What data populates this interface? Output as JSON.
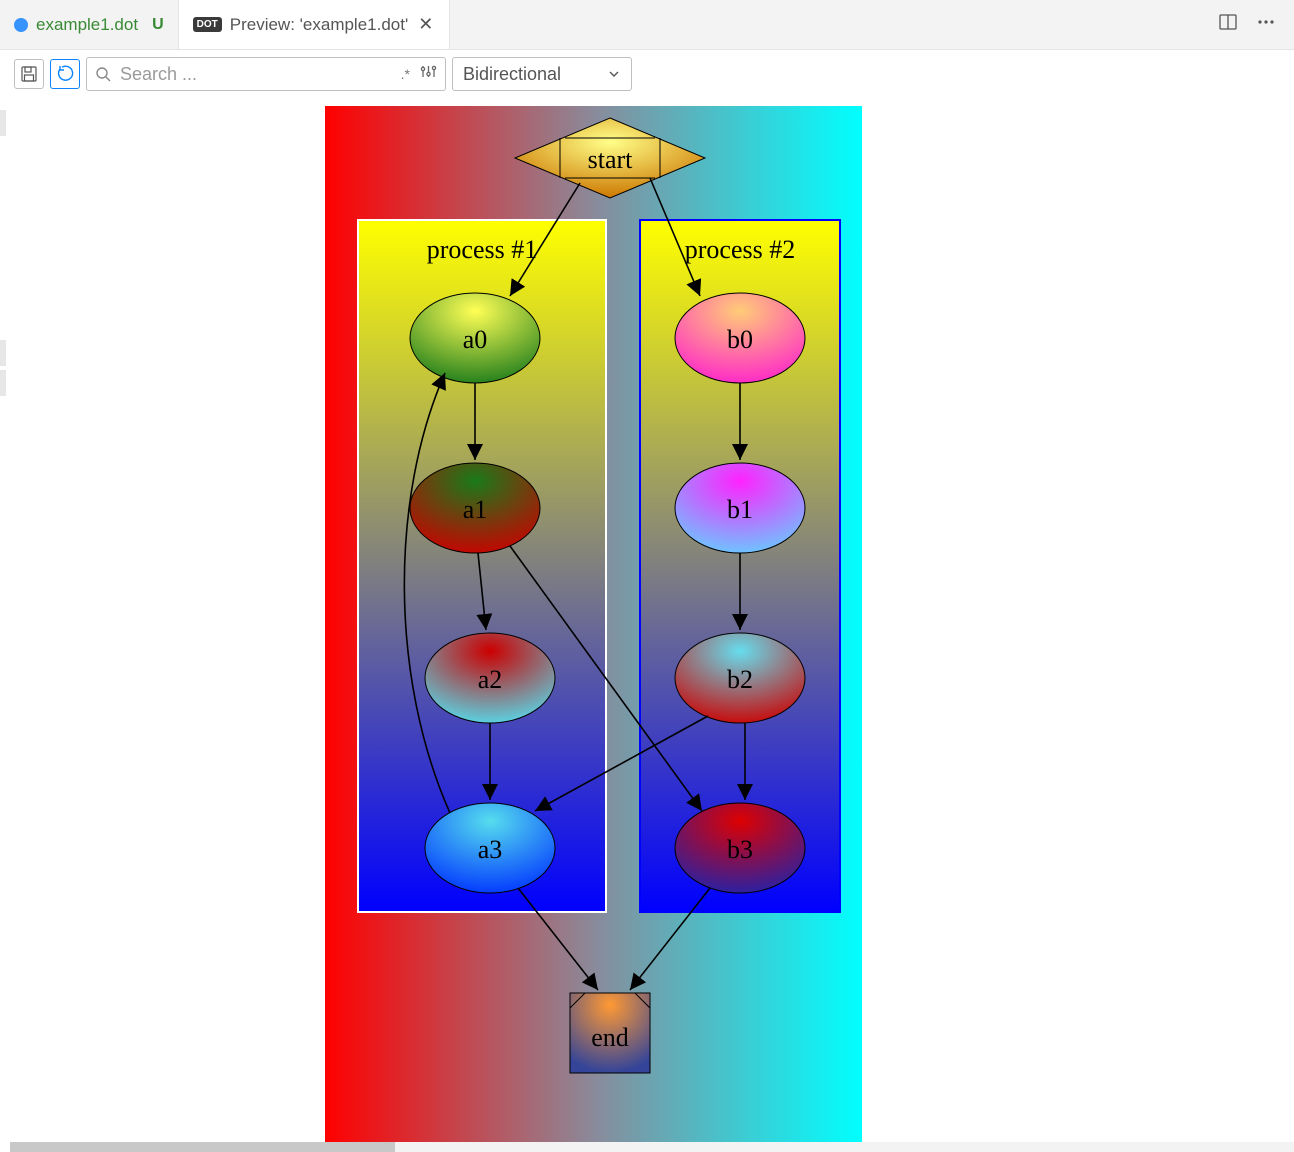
{
  "tabs": [
    {
      "label": "example1.dot",
      "status": "U",
      "icon": "dot-file"
    },
    {
      "label": "Preview: 'example1.dot'",
      "icon": "dot-preview"
    }
  ],
  "toolbar": {
    "search_placeholder": "Search ...",
    "direction_selected": "Bidirectional"
  },
  "graph": {
    "start_label": "start",
    "end_label": "end",
    "cluster1": {
      "title": "process #1",
      "nodes": [
        "a0",
        "a1",
        "a2",
        "a3"
      ]
    },
    "cluster2": {
      "title": "process #2",
      "nodes": [
        "b0",
        "b1",
        "b2",
        "b3"
      ]
    },
    "edges": [
      [
        "start",
        "a0"
      ],
      [
        "start",
        "b0"
      ],
      [
        "a0",
        "a1"
      ],
      [
        "a1",
        "a2"
      ],
      [
        "a2",
        "a3"
      ],
      [
        "b0",
        "b1"
      ],
      [
        "b1",
        "b2"
      ],
      [
        "b2",
        "b3"
      ],
      [
        "a1",
        "b3"
      ],
      [
        "b2",
        "a3"
      ],
      [
        "a3",
        "end"
      ],
      [
        "b3",
        "end"
      ],
      [
        "a3",
        "a0"
      ]
    ],
    "background": {
      "left_color": "#ff0000",
      "right_color": "#00ffff"
    },
    "cluster1_bg": {
      "top": "#ffff00",
      "bottom": "#0000ff",
      "stroke": "#ffffff"
    },
    "cluster2_bg": {
      "top": "#ffff00",
      "bottom": "#0000ff",
      "stroke": "#0000ff"
    },
    "node_colors": {
      "start": [
        "#ffff66",
        "#dd8800"
      ],
      "a0": [
        "#ffff66",
        "#228b22"
      ],
      "a1": [
        "#228b22",
        "#cc0000"
      ],
      "a2": [
        "#cc0000",
        "#33ccff"
      ],
      "a3": [
        "#33ccff",
        "#0033ff"
      ],
      "b0": [
        "#ffcc66",
        "#ff33cc"
      ],
      "b1": [
        "#ff33cc",
        "#66ccff"
      ],
      "b2": [
        "#66ccff",
        "#cc0000"
      ],
      "b3": [
        "#cc0000",
        "#2222aa"
      ],
      "end": [
        "#ff9933",
        "#223388"
      ]
    }
  }
}
